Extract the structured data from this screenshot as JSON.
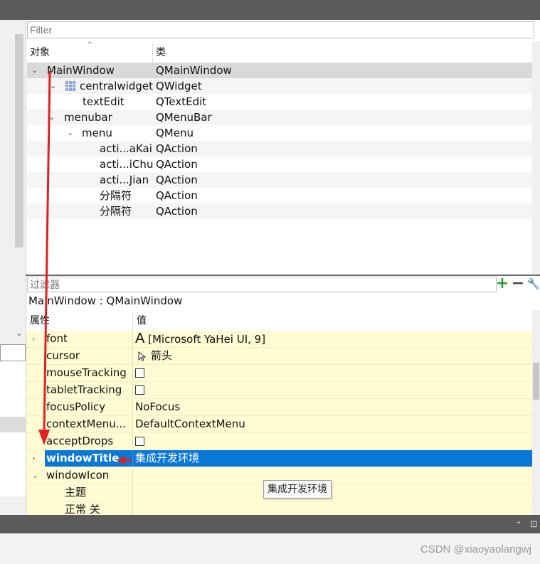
{
  "object_inspector": {
    "filter_placeholder": "Filter",
    "headers": {
      "object": "对象",
      "class": "类"
    },
    "rows": [
      {
        "name": "MainWindow",
        "class": "QMainWindow"
      },
      {
        "name": "centralwidget",
        "class": "QWidget"
      },
      {
        "name": "textEdit",
        "class": "QTextEdit"
      },
      {
        "name": "menubar",
        "class": "QMenuBar"
      },
      {
        "name": "menu",
        "class": "QMenu"
      },
      {
        "name": "acti...aKai",
        "class": "QAction"
      },
      {
        "name": "acti...iChu",
        "class": "QAction"
      },
      {
        "name": "acti...Jian",
        "class": "QAction"
      },
      {
        "name": "分隔符",
        "class": "QAction"
      },
      {
        "name": "分隔符",
        "class": "QAction"
      }
    ]
  },
  "property_editor": {
    "filter_placeholder": "过滤器",
    "class_label": "MainWindow : QMainWindow",
    "headers": {
      "property": "属性",
      "value": "值"
    },
    "rows": [
      {
        "name": "font",
        "value": "[Microsoft YaHei UI, 9]",
        "icon": "font-A-icon"
      },
      {
        "name": "cursor",
        "value": "箭头",
        "icon": "arrow-cursor-icon"
      },
      {
        "name": "mouseTracking",
        "value": ""
      },
      {
        "name": "tabletTracking",
        "value": ""
      },
      {
        "name": "focusPolicy",
        "value": "NoFocus"
      },
      {
        "name": "contextMenu...",
        "value": "DefaultContextMenu"
      },
      {
        "name": "acceptDrops",
        "value": ""
      },
      {
        "name": "windowTitle",
        "value": "集成开发环境"
      },
      {
        "name": "windowIcon",
        "value": ""
      },
      {
        "name": "主题",
        "value": ""
      },
      {
        "name": "正常 关",
        "value": ""
      }
    ],
    "tooltip": "集成开发环境"
  },
  "watermark": "CSDN @xiaoyaolangwj",
  "colors": {
    "selection": "#0a78d7",
    "property_bg": "#fffbd3",
    "annotation": "#e02020"
  }
}
